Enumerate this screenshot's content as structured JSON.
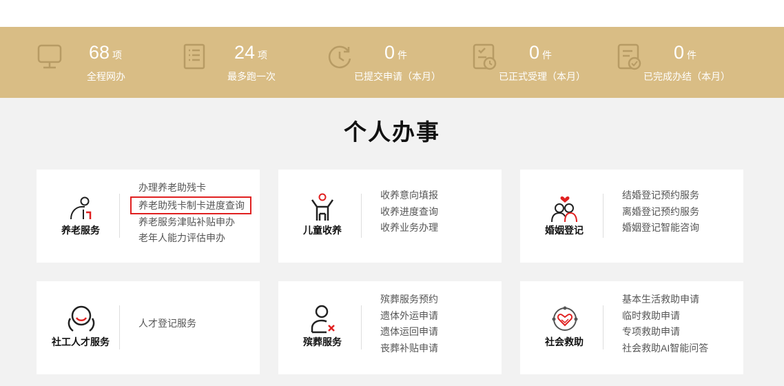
{
  "stats": [
    {
      "value": "68",
      "unit": "项",
      "label": "全程网办",
      "icon": "monitor-icon"
    },
    {
      "value": "24",
      "unit": "项",
      "label": "最多跑一次",
      "icon": "document-list-icon"
    },
    {
      "value": "0",
      "unit": "件",
      "label": "已提交申请（本月）",
      "icon": "clock-refresh-icon"
    },
    {
      "value": "0",
      "unit": "件",
      "label": "已正式受理（本月）",
      "icon": "clipboard-clock-icon"
    },
    {
      "value": "0",
      "unit": "件",
      "label": "已完成办结（本月）",
      "icon": "document-check-icon"
    }
  ],
  "section_title": "个人办事",
  "cards": [
    {
      "name": "养老服务",
      "icon": "elderly-icon",
      "links": [
        "办理养老助残卡",
        "养老助残卡制卡进度查询",
        "养老服务津贴补贴申办",
        "老年人能力评估申办"
      ],
      "highlighted": 1
    },
    {
      "name": "儿童收养",
      "icon": "child-icon",
      "links": [
        "收养意向填报",
        "收养进度查询",
        "收养业务办理"
      ],
      "highlighted": -1
    },
    {
      "name": "婚姻登记",
      "icon": "couple-icon",
      "links": [
        "结婚登记预约服务",
        "离婚登记预约服务",
        "婚姻登记智能咨询"
      ],
      "highlighted": -1
    },
    {
      "name": "社工人才服务",
      "icon": "social-worker-icon",
      "links": [
        "人才登记服务"
      ],
      "highlighted": -1
    },
    {
      "name": "殡葬服务",
      "icon": "funeral-person-icon",
      "links": [
        "殡葬服务预约",
        "遗体外运申请",
        "遗体运回申请",
        "丧葬补贴申请"
      ],
      "highlighted": -1
    },
    {
      "name": "社会救助",
      "icon": "handshake-heart-icon",
      "links": [
        "基本生活救助申请",
        "临时救助申请",
        "专项救助申请",
        "社会救助AI智能问答"
      ],
      "highlighted": -1
    }
  ],
  "colors": {
    "banner": "#d9bd85",
    "highlight_border": "#e02020",
    "accent_red": "#e02020"
  }
}
